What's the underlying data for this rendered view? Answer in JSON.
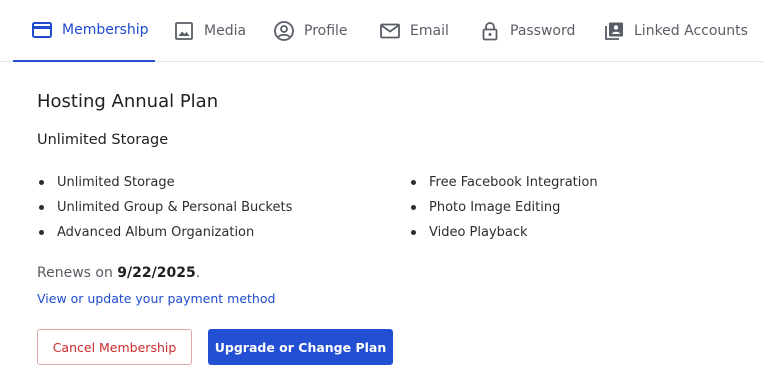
{
  "tabs": [
    {
      "label": "Membership",
      "icon": "credit-card-icon"
    },
    {
      "label": "Media",
      "icon": "image-icon"
    },
    {
      "label": "Profile",
      "icon": "user-circle-icon"
    },
    {
      "label": "Email",
      "icon": "mail-icon"
    },
    {
      "label": "Password",
      "icon": "lock-icon"
    },
    {
      "label": "Linked Accounts",
      "icon": "linked-accounts-icon"
    }
  ],
  "active_tab": "Membership",
  "plan": {
    "title": "Hosting Annual Plan",
    "subtitle": "Unlimited Storage",
    "features_left": [
      "Unlimited Storage",
      "Unlimited Group & Personal Buckets",
      "Advanced Album Organization"
    ],
    "features_right": [
      "Free Facebook Integration",
      "Photo Image Editing",
      "Video Playback"
    ]
  },
  "renewal": {
    "prefix": "Renews on ",
    "date": "9/22/2025",
    "suffix": "."
  },
  "payment_link": "View or update your payment method",
  "buttons": {
    "cancel": "Cancel Membership",
    "upgrade": "Upgrade or Change Plan"
  },
  "colors": {
    "accent": "#2350d3",
    "danger": "#cc2b2b",
    "muted_text": "#595d66"
  }
}
